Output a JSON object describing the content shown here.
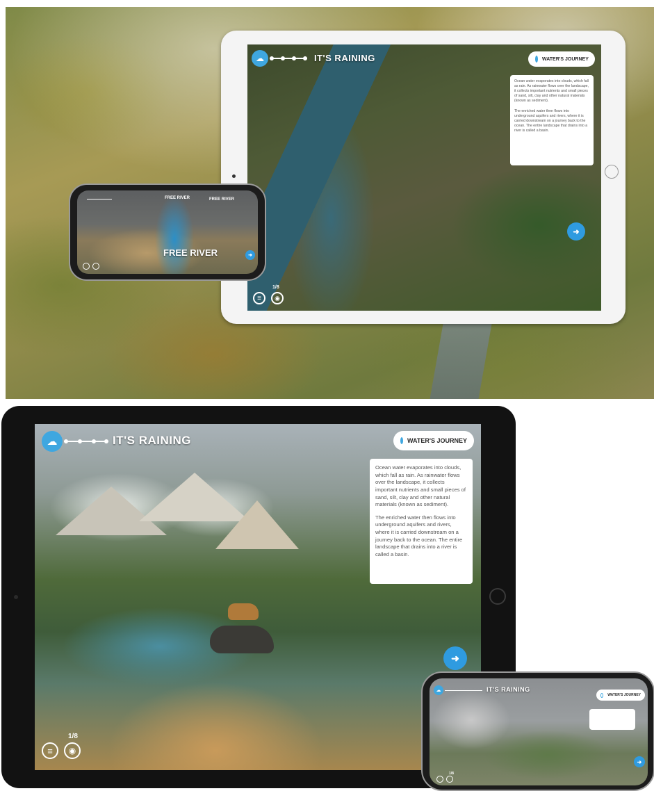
{
  "top_ipad": {
    "title": "IT'S RAINING",
    "journey_button": "WATER'S JOURNEY",
    "info_p1": "Ocean water evaporates into clouds, which fall as rain. As rainwater flows over the landscape, it collects important nutrients and small pieces of sand, silt, clay and other natural materials (known as sediment).",
    "info_p2": "The enriched water then flows into underground aquifers and rivers, where it is carried downstream on a journey back to the ocean. The entire landscape that drains into a river is called a basin.",
    "page_counter": "1/8"
  },
  "top_iphone": {
    "label_1": "FREE RIVER",
    "label_2": "FREE RIVER",
    "banner": "FREE RIVER"
  },
  "bottom_ipad": {
    "title": "IT'S RAINING",
    "journey_button": "WATER'S JOURNEY",
    "info_p1": "Ocean water evaporates into clouds, which fall as rain. As rainwater flows over the landscape, it collects important nutrients and small pieces of sand, silt, clay and other natural materials (known as sediment).",
    "info_p2": "The enriched water then flows into underground aquifers and rivers, where it is carried downstream on a journey back to the ocean. The entire landscape that drains into a river is called a basin.",
    "page_counter": "1/8"
  },
  "bottom_iphone": {
    "title": "IT'S RAINING",
    "journey_button": "WATER'S JOURNEY",
    "page_counter": "1/8"
  },
  "icons": {
    "cloud": "☁",
    "next": "➜",
    "menu": "≡",
    "eye": "◉"
  },
  "colors": {
    "accent_blue": "#2f9be0",
    "cloud_blue": "#3fa7e0"
  }
}
